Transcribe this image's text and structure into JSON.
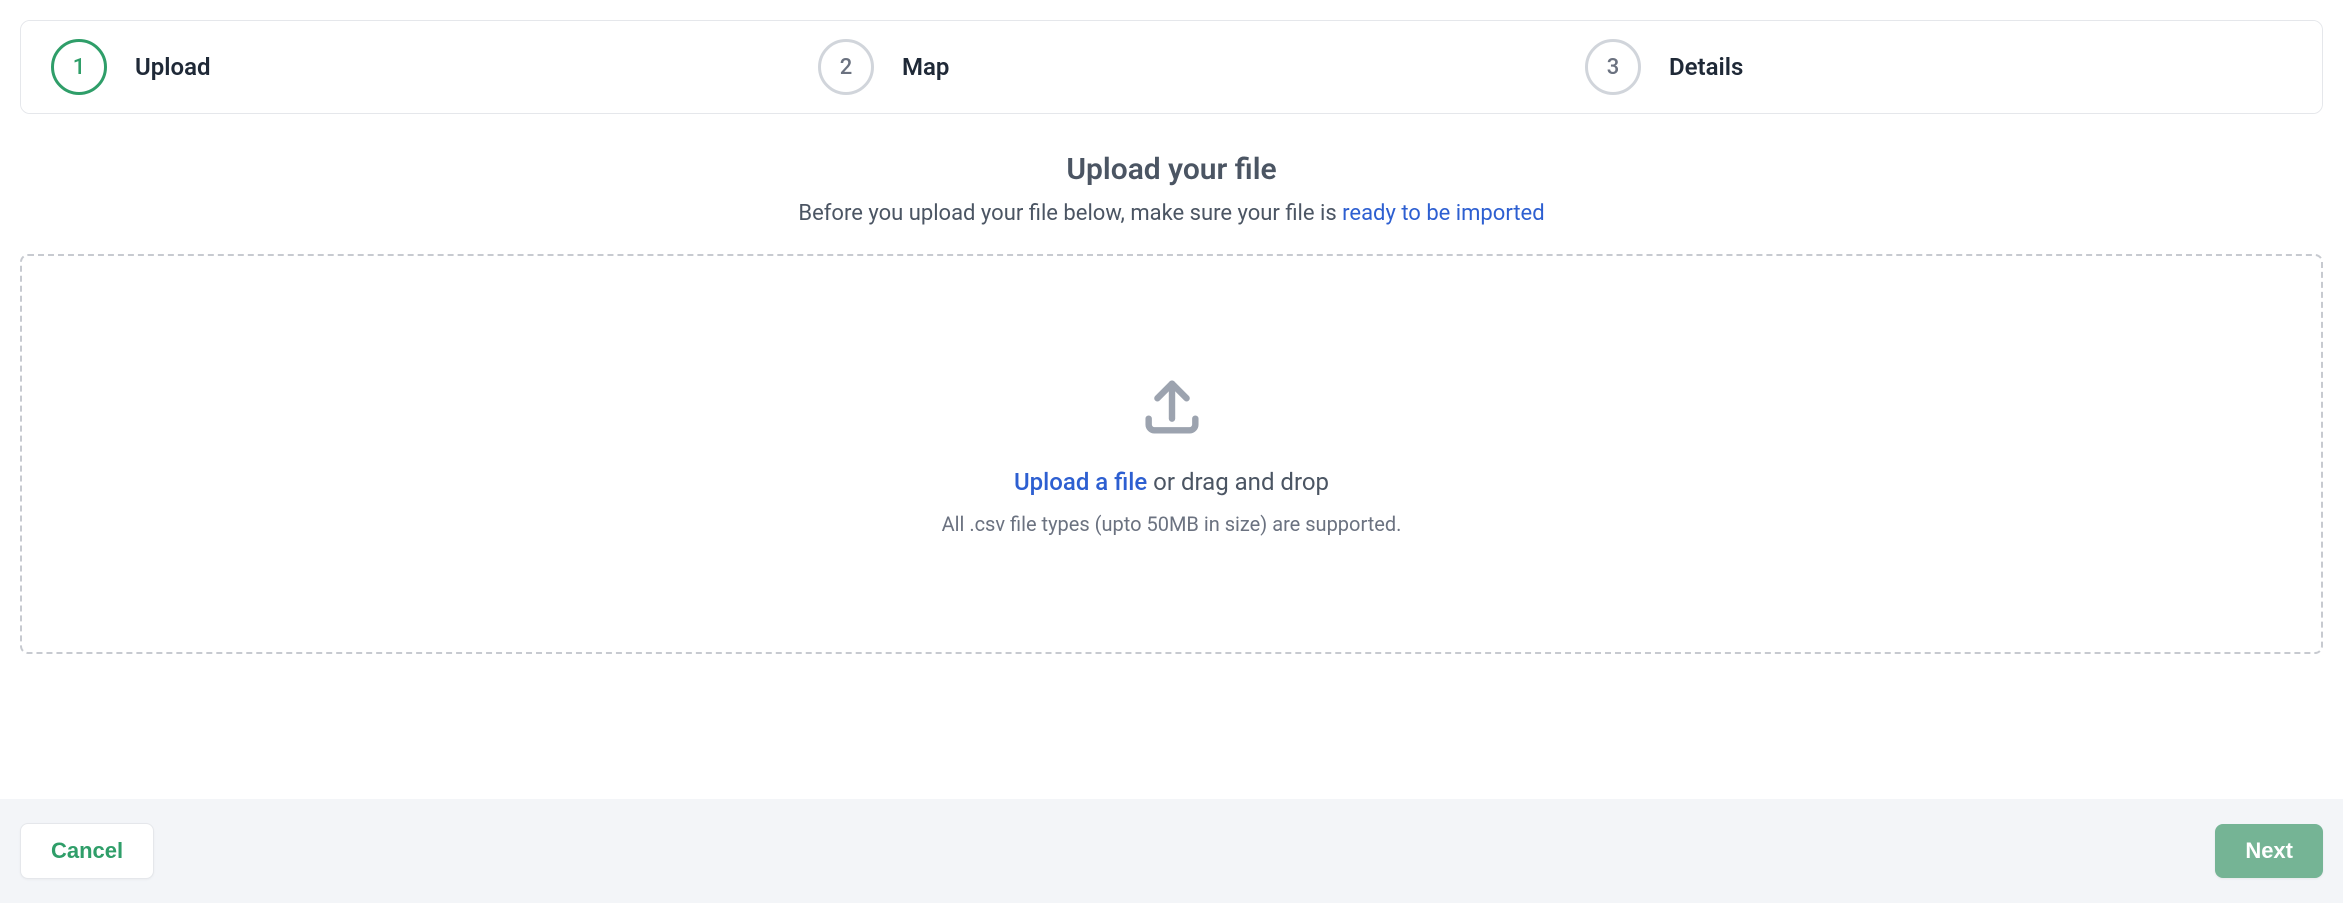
{
  "stepper": {
    "steps": [
      {
        "num": "1",
        "label": "Upload",
        "active": true
      },
      {
        "num": "2",
        "label": "Map",
        "active": false
      },
      {
        "num": "3",
        "label": "Details",
        "active": false
      }
    ]
  },
  "heading": {
    "title": "Upload your file",
    "subtitle_prefix": "Before you upload your file below, make sure your file is ",
    "subtitle_link": "ready to be imported"
  },
  "dropzone": {
    "link_text": "Upload a file",
    "rest_text": " or drag and drop",
    "hint": "All .csv file types (upto 50MB in size) are supported."
  },
  "footer": {
    "cancel": "Cancel",
    "next": "Next"
  }
}
